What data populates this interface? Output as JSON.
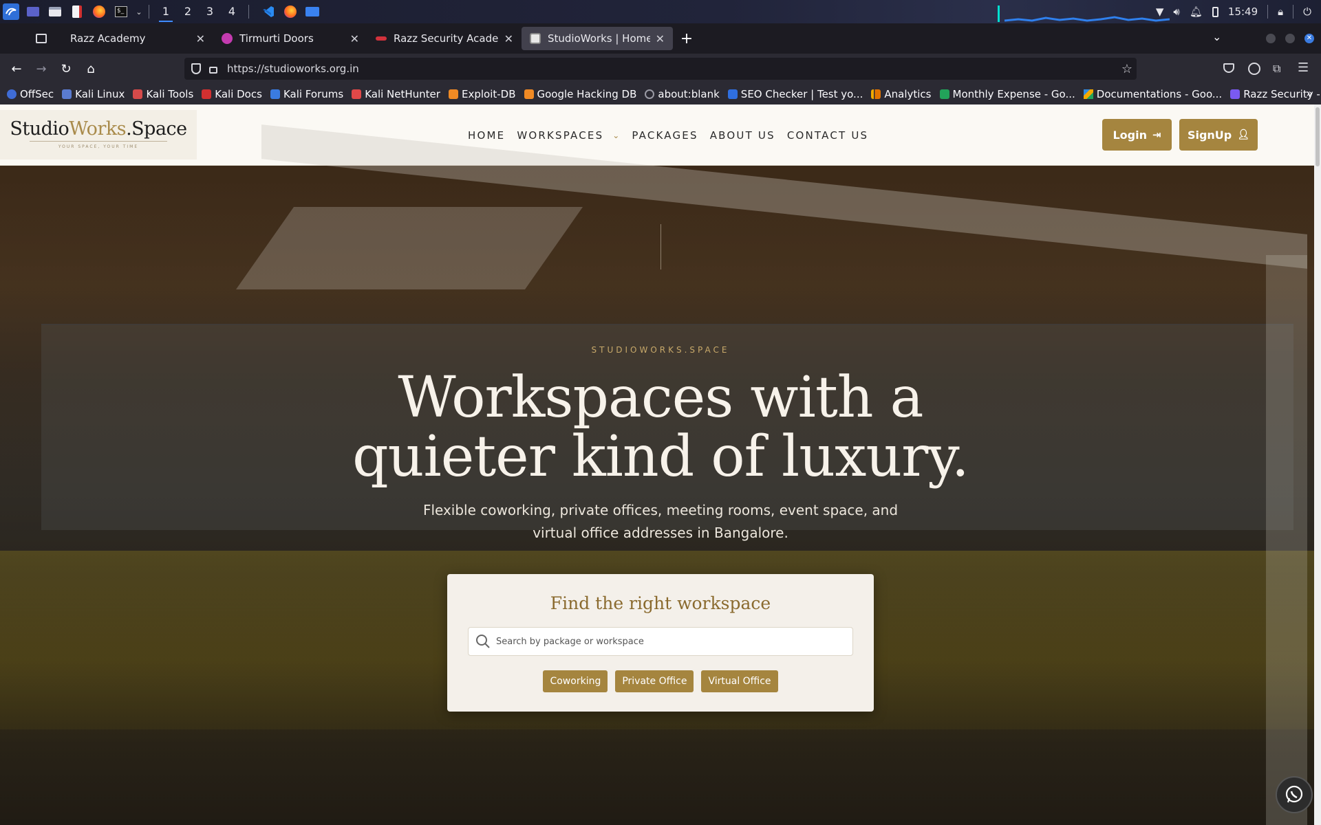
{
  "taskbar": {
    "workspaces": [
      "1",
      "2",
      "3",
      "4"
    ],
    "clock": "15:49"
  },
  "tabs": [
    {
      "title": "Razz Academy",
      "favicon_color": "#2b2a33"
    },
    {
      "title": "Tirmurti Doors",
      "favicon_color": "#c43bb0"
    },
    {
      "title": "Razz Security Academy | (",
      "favicon_color": "#d2323c"
    },
    {
      "title": "StudioWorks | Home",
      "favicon_color": "#e8e8e8"
    }
  ],
  "url": "https://studioworks.org.in",
  "bookmarks": [
    {
      "label": "OffSec",
      "color": "#3f6cd6"
    },
    {
      "label": "Kali Linux",
      "color": "#5a7bd0"
    },
    {
      "label": "Kali Tools",
      "color": "#d54a4a"
    },
    {
      "label": "Kali Docs",
      "color": "#d23030"
    },
    {
      "label": "Kali Forums",
      "color": "#3a7be0"
    },
    {
      "label": "Kali NetHunter",
      "color": "#e04848"
    },
    {
      "label": "Exploit-DB",
      "color": "#f08a24"
    },
    {
      "label": "Google Hacking DB",
      "color": "#f08a24"
    },
    {
      "label": "about:blank",
      "color": "#9a9aa4"
    },
    {
      "label": "SEO Checker | Test yo...",
      "color": "#2f6fe0"
    },
    {
      "label": "Analytics",
      "color": "#f2a900"
    },
    {
      "label": "Monthly Expense - Go...",
      "color": "#22a35a"
    },
    {
      "label": "Documentations - Goo...",
      "color": "#2f8ae0"
    },
    {
      "label": "Razz Security - Busine...",
      "color": "#7a5af0"
    }
  ],
  "site": {
    "logo_main_a": "Studio",
    "logo_main_b": "Works",
    "logo_main_c": ".Space",
    "logo_tagline": "YOUR SPACE, YOUR TIME",
    "nav": [
      "HOME",
      "WORKSPACES",
      "PACKAGES",
      "ABOUT US",
      "CONTACT US"
    ],
    "nav_caret": "⌄",
    "login": "Login",
    "signup": "SignUp",
    "eyebrow": "STUDIOWORKS.SPACE",
    "headline_line1": "Workspaces with a",
    "headline_line2": "quieter kind of luxury.",
    "subtext_line1": "Flexible coworking, private offices, meeting rooms, event space, and",
    "subtext_line2": "virtual office addresses in Bangalore.",
    "finder_title": "Find the right workspace",
    "search_placeholder": "Search by package or workspace",
    "chips": [
      "Coworking",
      "Private Office",
      "Virtual Office"
    ],
    "accent_color": "#a5853f"
  }
}
